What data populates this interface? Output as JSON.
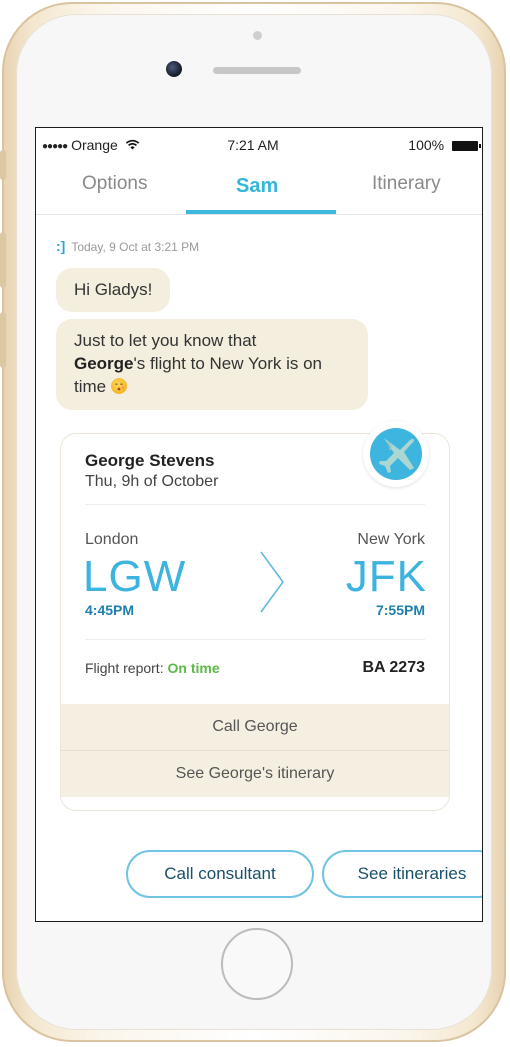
{
  "status_bar": {
    "signal": "●●●●●",
    "carrier": "Orange",
    "time": "7:21 AM",
    "battery": "100%"
  },
  "tabs": [
    {
      "label": "Options"
    },
    {
      "label": "Sam"
    },
    {
      "label": "Itinerary"
    }
  ],
  "chat": {
    "timestamp": "Today, 9 Oct at 3:21 PM",
    "message_1": "Hi Gladys!",
    "message_2_pre": "Just to let you know that",
    "message_2_name": "George",
    "message_2_post": "'s flight to New York is on time"
  },
  "flight_card": {
    "passenger": "George Stevens",
    "date": "Thu, 9h of October",
    "origin": {
      "city": "London",
      "code": "LGW",
      "time": "4:45PM"
    },
    "destination": {
      "city": "New York",
      "code": "JFK",
      "time": "7:55PM"
    },
    "report_label": "Flight report:",
    "report_status": "On time",
    "flight_number": "BA 2273",
    "actions": [
      "Call George",
      "See George's itinerary"
    ]
  },
  "quick_replies": [
    "Call consultant",
    "See itineraries"
  ],
  "colors": {
    "accent": "#3cb4df",
    "bubble": "#f3eedd",
    "on_time": "#5cb947",
    "gold_frame": "#e7d2b0"
  },
  "icons": [
    "wifi-icon",
    "battery-icon",
    "bot-logo-icon",
    "emoji-icon",
    "airplane-icon",
    "chevron-right-icon"
  ]
}
